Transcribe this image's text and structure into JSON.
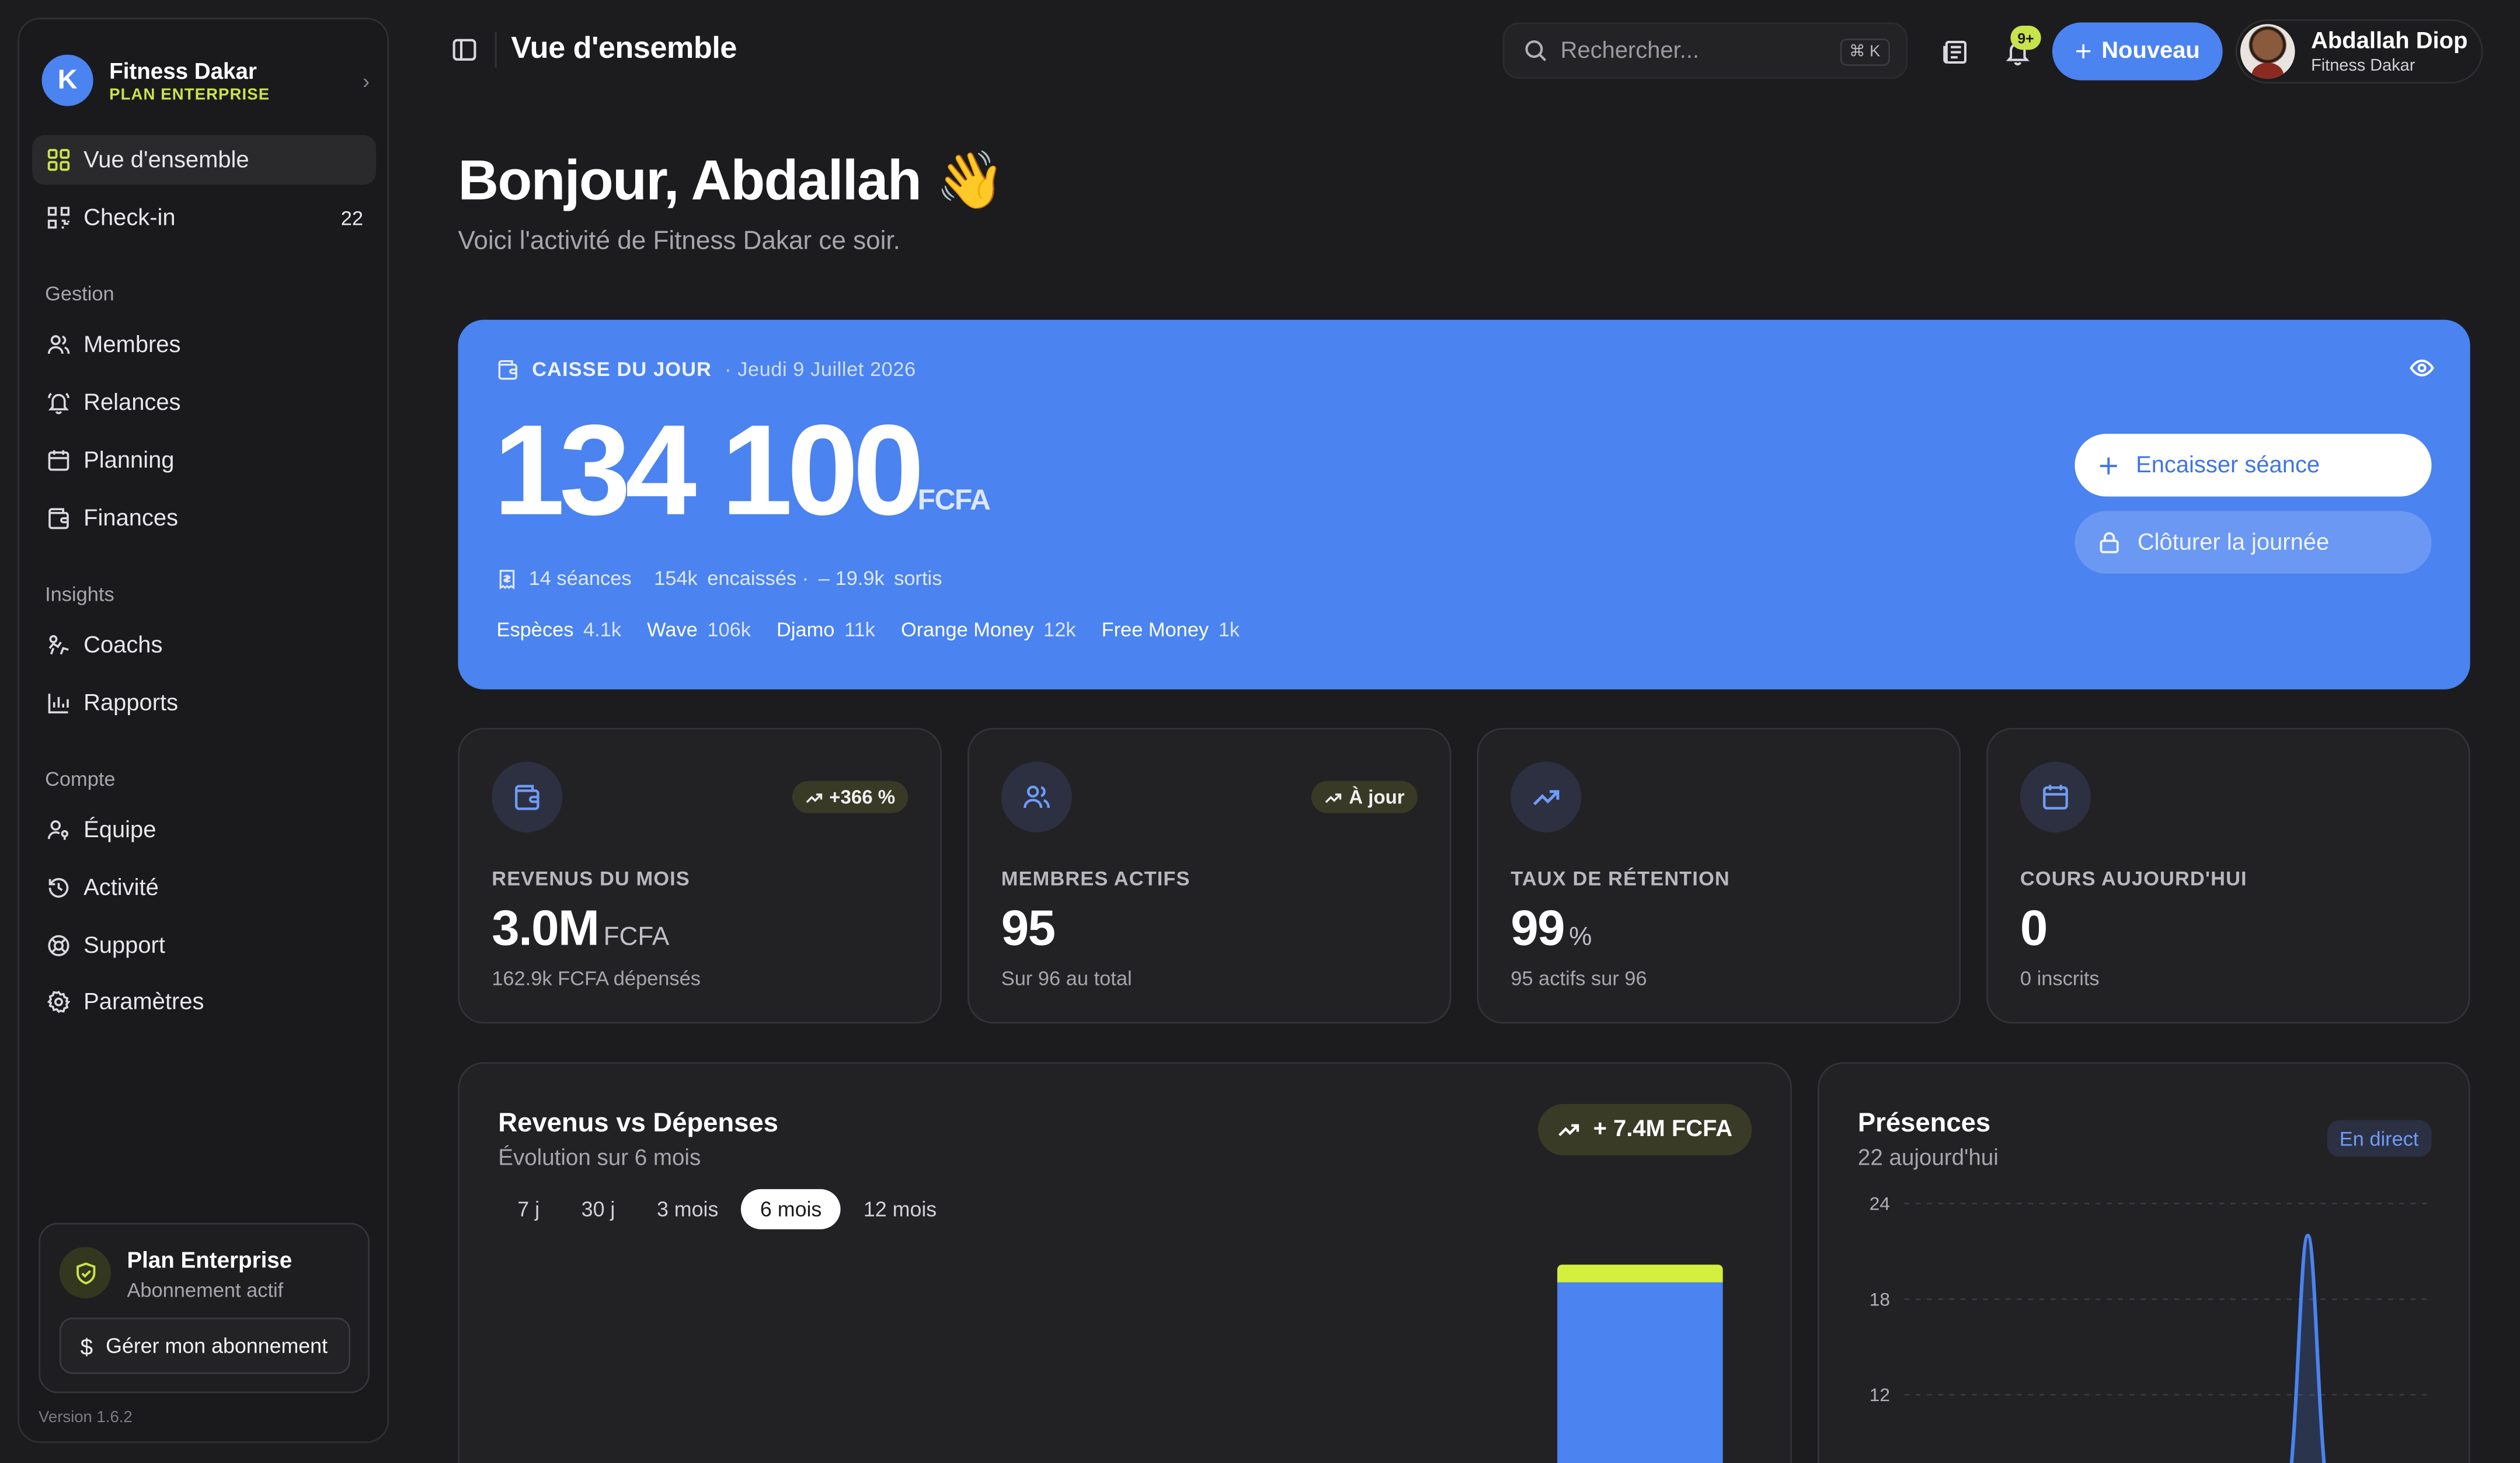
{
  "sidebar": {
    "org_initial": "K",
    "org_name": "Fitness Dakar",
    "org_plan": "PLAN ENTERPRISE",
    "items_top": [
      {
        "label": "Vue d'ensemble",
        "icon": "grid-icon",
        "active": true
      },
      {
        "label": "Check-in",
        "icon": "qr-code-icon",
        "count": "22"
      }
    ],
    "section_gestion": "Gestion",
    "gestion": [
      {
        "label": "Membres",
        "icon": "users-icon"
      },
      {
        "label": "Relances",
        "icon": "bell-ring-icon"
      },
      {
        "label": "Planning",
        "icon": "calendar-icon"
      },
      {
        "label": "Finances",
        "icon": "wallet-icon"
      }
    ],
    "section_insights": "Insights",
    "insights": [
      {
        "label": "Coachs",
        "icon": "coach-icon"
      },
      {
        "label": "Rapports",
        "icon": "bar-chart-icon"
      }
    ],
    "section_compte": "Compte",
    "compte": [
      {
        "label": "Équipe",
        "icon": "user-key-icon"
      },
      {
        "label": "Activité",
        "icon": "history-icon"
      },
      {
        "label": "Support",
        "icon": "lifebuoy-icon"
      },
      {
        "label": "Paramètres",
        "icon": "gear-icon"
      }
    ],
    "plan_title": "Plan Enterprise",
    "plan_sub": "Abonnement actif",
    "plan_button": "Gérer mon abonnement",
    "version": "Version 1.6.2"
  },
  "header": {
    "title": "Vue d'ensemble",
    "search_placeholder": "Rechercher...",
    "search_shortcut": "⌘ K",
    "notif_count": "9+",
    "new_button": "Nouveau",
    "user_name": "Abdallah Diop",
    "user_org": "Fitness Dakar"
  },
  "greeting": {
    "title": "Bonjour, Abdallah 👋",
    "subtitle": "Voici l'activité de Fitness Dakar ce soir."
  },
  "cash": {
    "title": "CAISSE DU JOUR",
    "date": "· Jeudi 9 Juillet 2026",
    "amount": "134 100",
    "currency": "FCFA",
    "sessions": "14 séances",
    "collected_value": "154k",
    "collected_label": "encaissés ·",
    "out_value": "– 19.9k",
    "out_label": "sortis",
    "methods": [
      {
        "label": "Espèces",
        "value": "4.1k"
      },
      {
        "label": "Wave",
        "value": "106k"
      },
      {
        "label": "Djamo",
        "value": "11k"
      },
      {
        "label": "Orange Money",
        "value": "12k"
      },
      {
        "label": "Free Money",
        "value": "1k"
      }
    ],
    "button_collect": "Encaisser séance",
    "button_close": "Clôturer la journée"
  },
  "stats": [
    {
      "label": "REVENUS DU MOIS",
      "value": "3.0M",
      "unit": "FCFA",
      "sub": "162.9k FCFA dépensés",
      "badge": "+366 %",
      "icon": "wallet-icon"
    },
    {
      "label": "MEMBRES ACTIFS",
      "value": "95",
      "unit": "",
      "sub": "Sur 96 au total",
      "badge": "À jour",
      "icon": "users-icon"
    },
    {
      "label": "TAUX DE RÉTENTION",
      "value": "99",
      "unit": "%",
      "sub": "95 actifs sur 96",
      "badge": "",
      "icon": "trending-up-icon"
    },
    {
      "label": "COURS AUJOURD'HUI",
      "value": "0",
      "unit": "",
      "sub": "0 inscrits",
      "badge": "",
      "icon": "calendar-icon"
    }
  ],
  "revenue": {
    "title": "Revenus vs Dépenses",
    "subtitle": "Évolution sur 6 mois",
    "total": "+ 7.4M  FCFA",
    "tabs": [
      "7 j",
      "30 j",
      "3 mois",
      "6 mois",
      "12 mois"
    ],
    "active_tab": "6 mois",
    "colors": {
      "revenue": "#4b83f0",
      "expenses": "#d4ef3e"
    }
  },
  "presences": {
    "title": "Présences",
    "subtitle": "22 aujourd'hui",
    "live": "En direct",
    "color": "#4b83f0"
  },
  "chart_data": {
    "type": "line",
    "y_ticks": [
      "24",
      "18",
      "12"
    ],
    "ylim": [
      0,
      24
    ],
    "peak_value": 22,
    "grid": true
  }
}
